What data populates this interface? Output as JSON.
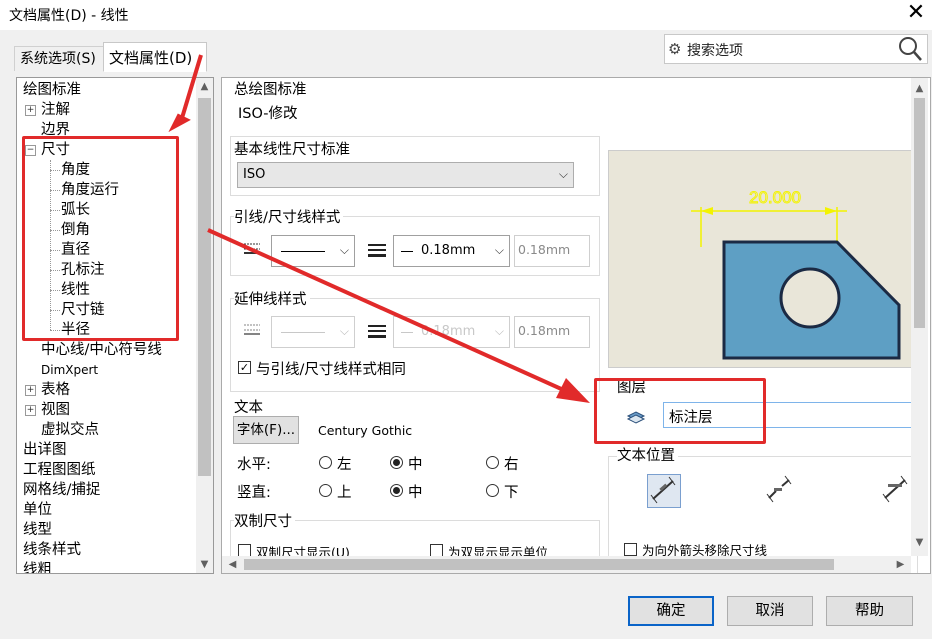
{
  "window": {
    "title": "文档属性(D) - 线性",
    "close_glyph": "✕"
  },
  "tabs": [
    {
      "label": "系统选项(S)"
    },
    {
      "label": "文档属性(D)"
    }
  ],
  "search": {
    "placeholder": "搜索选项"
  },
  "tree": {
    "items": [
      {
        "label": "绘图标准"
      },
      {
        "label": "注解"
      },
      {
        "label": "边界"
      },
      {
        "label": "尺寸"
      },
      {
        "label": "角度"
      },
      {
        "label": "角度运行"
      },
      {
        "label": "弧长"
      },
      {
        "label": "倒角"
      },
      {
        "label": "直径"
      },
      {
        "label": "孔标注"
      },
      {
        "label": "线性"
      },
      {
        "label": "尺寸链"
      },
      {
        "label": "半径"
      },
      {
        "label": "中心线/中心符号线"
      },
      {
        "label": "DimXpert"
      },
      {
        "label": "表格"
      },
      {
        "label": "视图"
      },
      {
        "label": "虚拟交点"
      },
      {
        "label": "出详图"
      },
      {
        "label": "工程图图纸"
      },
      {
        "label": "网格线/捕捉"
      },
      {
        "label": "单位"
      },
      {
        "label": "线型"
      },
      {
        "label": "线条样式"
      },
      {
        "label": "线粗"
      }
    ]
  },
  "panel": {
    "overall_standard": {
      "heading": "总绘图标准",
      "value": "ISO-修改"
    },
    "base_standard": {
      "heading": "基本线性尺寸标准",
      "value": "ISO"
    },
    "leader_style": {
      "heading": "引线/尺寸线样式",
      "thickness": "0.18mm",
      "custom": "0.18mm"
    },
    "extension_style": {
      "heading": "延伸线样式",
      "thickness": "0.18mm",
      "custom": "0.18mm",
      "same_label": "与引线/尺寸线样式相同"
    },
    "text": {
      "heading": "文本",
      "font_button": "字体(F)...",
      "font_name": "Century Gothic",
      "horizontal_label": "水平:",
      "vertical_label": "竖直:",
      "h_options": [
        "左",
        "中",
        "右"
      ],
      "v_options": [
        "上",
        "中",
        "下"
      ],
      "h_selected": "中",
      "v_selected": "中"
    },
    "dual": {
      "heading": "双制尺寸",
      "show_dual": "双制尺寸显示(U)",
      "dual_units": "为双显示显示单位"
    },
    "preview": {
      "dimension_text": "20.000"
    },
    "layer": {
      "heading": "图层",
      "value": "标注层"
    },
    "text_position": {
      "heading": "文本位置",
      "remove_units": "为向外箭头移除尺寸线"
    }
  },
  "footer": {
    "ok": "确定",
    "cancel": "取消",
    "help": "帮助"
  },
  "colors": {
    "annotation_red": "#e12a2a",
    "part_fill": "#5e9fc4",
    "preview_bg": "#e9e6d9",
    "dim_yellow": "#f3f300"
  }
}
